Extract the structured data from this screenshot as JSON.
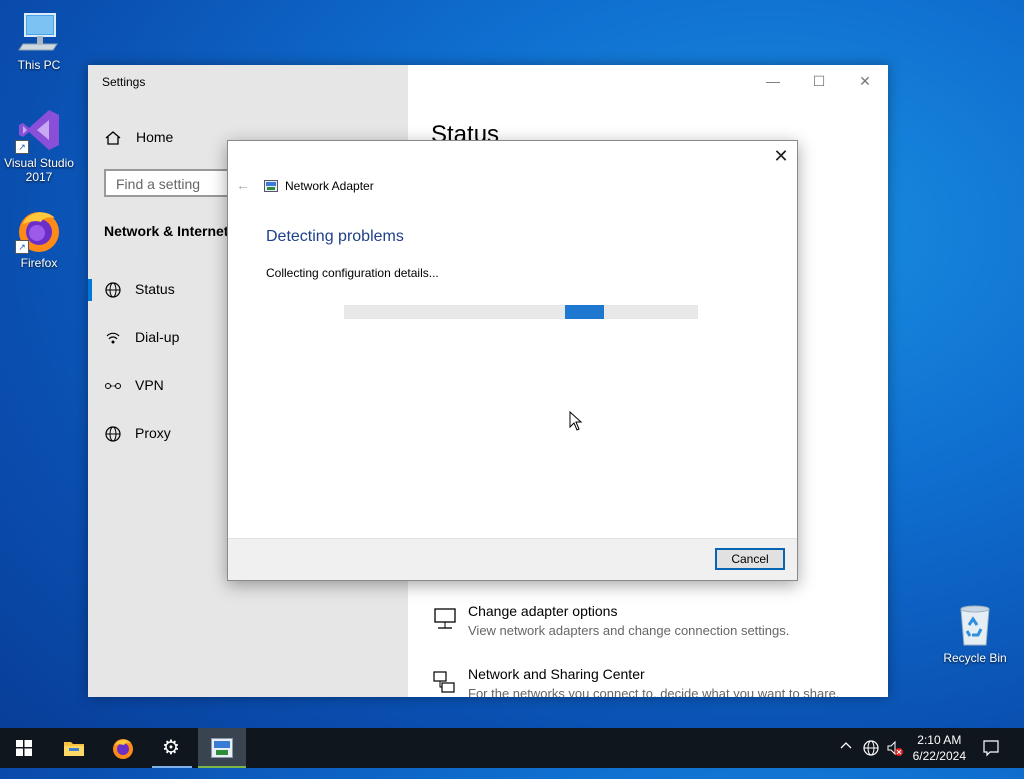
{
  "desktop": {
    "icons": [
      {
        "label": "This PC",
        "name": "this-pc-icon"
      },
      {
        "label": "Visual Studio 2017",
        "name": "visual-studio-icon"
      },
      {
        "label": "Firefox",
        "name": "firefox-icon"
      },
      {
        "label": "Recycle Bin",
        "name": "recycle-bin-icon"
      }
    ]
  },
  "settings": {
    "title": "Settings",
    "controls": {
      "minimize": "—",
      "maximize": "☐",
      "close": "✕"
    },
    "home": "Home",
    "search_placeholder": "Find a setting",
    "section": "Network & Internet",
    "nav": [
      {
        "label": "Status",
        "icon": "globe-status-icon",
        "active": true
      },
      {
        "label": "Dial-up",
        "icon": "dialup-icon",
        "active": false
      },
      {
        "label": "VPN",
        "icon": "vpn-icon",
        "active": false
      },
      {
        "label": "Proxy",
        "icon": "globe-icon",
        "active": false
      }
    ],
    "page_heading": "Status",
    "links": [
      {
        "title": "Change adapter options",
        "desc": "View network adapters and change connection settings.",
        "icon": "adapter-icon"
      },
      {
        "title": "Network and Sharing Center",
        "desc": "For the networks you connect to, decide what you want to share.",
        "icon": "sharing-center-icon"
      }
    ]
  },
  "dialog": {
    "close": "✕",
    "back": "←",
    "app_title": "Network Adapter",
    "heading": "Detecting problems",
    "status_text": "Collecting configuration details...",
    "progress_position": 0.7,
    "cancel": "Cancel"
  },
  "taskbar": {
    "apps": [
      {
        "name": "start-button",
        "icon": "windows-logo-icon"
      },
      {
        "name": "file-explorer-button",
        "icon": "folder-icon"
      },
      {
        "name": "firefox-button",
        "icon": "firefox-icon"
      },
      {
        "name": "settings-button",
        "icon": "gear-icon"
      },
      {
        "name": "network-adapter-button",
        "icon": "network-troubleshooter-icon"
      }
    ],
    "time": "2:10 AM",
    "date": "6/22/2024"
  }
}
